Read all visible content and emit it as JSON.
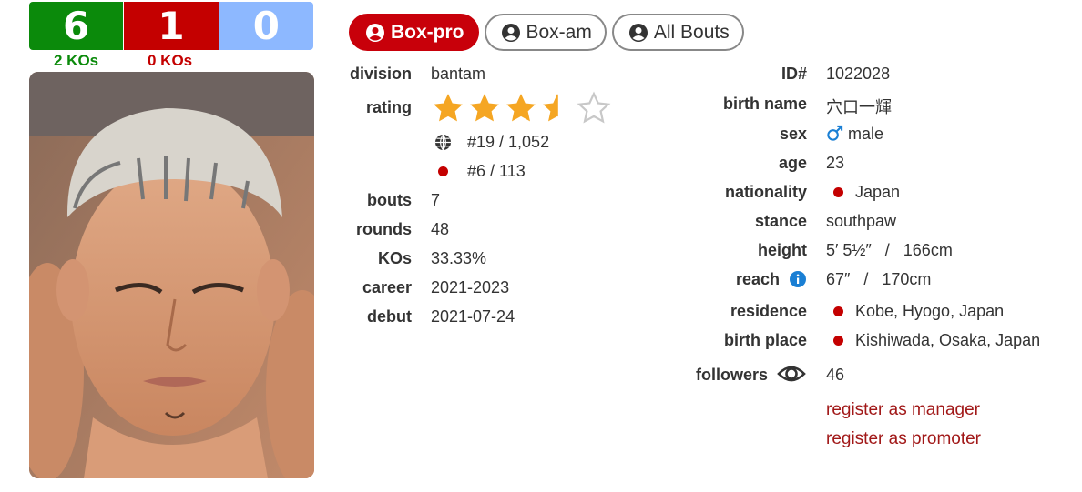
{
  "record": {
    "wins": "6",
    "losses": "1",
    "draws": "0",
    "win_kos": "2 KOs",
    "loss_kos": "0 KOs"
  },
  "tabs": [
    {
      "label": "Box-pro",
      "active": true
    },
    {
      "label": "Box-am",
      "active": false
    },
    {
      "label": "All Bouts",
      "active": false
    }
  ],
  "left": {
    "division": {
      "label": "division",
      "value": "bantam"
    },
    "rating": {
      "label": "rating",
      "stars": 3.5,
      "max": 5
    },
    "world_rank": "#19 / 1,052",
    "country_rank": "#6 / 113",
    "bouts": {
      "label": "bouts",
      "value": "7"
    },
    "rounds": {
      "label": "rounds",
      "value": "48"
    },
    "kos": {
      "label": "KOs",
      "value": "33.33%"
    },
    "career": {
      "label": "career",
      "value": "2021-2023"
    },
    "debut": {
      "label": "debut",
      "value": "2021-07-24"
    }
  },
  "right": {
    "id": {
      "label": "ID#",
      "value": "1022028"
    },
    "birth_name": {
      "label": "birth name",
      "value": "穴口一輝"
    },
    "sex": {
      "label": "sex",
      "value": "male"
    },
    "age": {
      "label": "age",
      "value": "23"
    },
    "nationality": {
      "label": "nationality",
      "value": "Japan"
    },
    "stance": {
      "label": "stance",
      "value": "southpaw"
    },
    "height": {
      "label": "height",
      "value": "5′ 5½″   /   166cm"
    },
    "reach": {
      "label": "reach",
      "value": "67″   /   170cm"
    },
    "residence": {
      "label": "residence",
      "value": "Kobe, Hyogo, Japan"
    },
    "birth_place": {
      "label": "birth place",
      "value": "Kishiwada, Osaka, Japan"
    },
    "followers": {
      "label": "followers",
      "value": "46"
    },
    "register_manager": "register as manager",
    "register_promoter": "register as promoter"
  },
  "colors": {
    "win": "#0b8a0b",
    "loss": "#c40000",
    "draw": "#8db8ff",
    "star": "#f5a623",
    "link": "#a11818",
    "info": "#1a7fd4"
  }
}
